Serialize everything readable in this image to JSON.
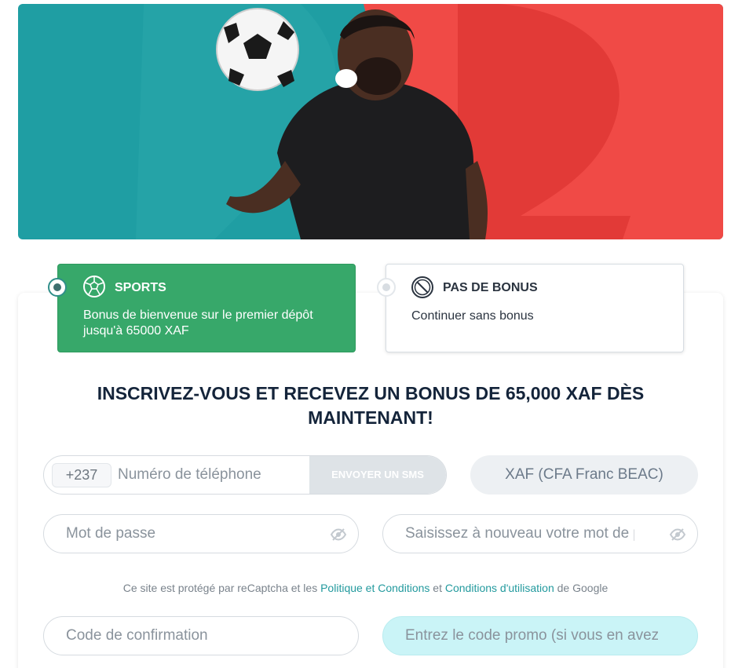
{
  "bonus_options": {
    "sports": {
      "title": "SPORTS",
      "description_line1": "Bonus de bienvenue sur le premier dépôt",
      "description_line2": "jusqu'à 65000 XAF",
      "icon": "soccer-ball-icon",
      "selected": true,
      "color": "#37a86a"
    },
    "no_bonus": {
      "title": "PAS DE BONUS",
      "description": "Continuer sans bonus",
      "icon": "prohibited-icon",
      "selected": false
    }
  },
  "heading": {
    "line1": "INSCRIVEZ-VOUS ET RECEVEZ UN BONUS DE 65,000 XAF DÈS",
    "line2": "MAINTENANT!"
  },
  "form": {
    "phone_prefix": "+237",
    "phone_placeholder": "Numéro de téléphone",
    "send_sms_label": "ENVOYER UN SMS",
    "currency": "XAF (CFA Franc BEAC)",
    "password_placeholder": "Mot de passe",
    "password_repeat_placeholder": "Saisissez à nouveau votre mot de passe",
    "confirmation_code_placeholder": "Code de confirmation",
    "promo_code_placeholder": "Entrez le code promo (si vous en avez)"
  },
  "recaptcha": {
    "prefix": "Ce site est protégé par reCaptcha et les",
    "policy_link": "Politique et Conditions",
    "middle": "et",
    "terms_link": "Conditions d'utilisation",
    "suffix": "de Google"
  },
  "colors": {
    "banner_teal": "#1f9ea3",
    "banner_red": "#f04a46",
    "accent_link": "#239a9e",
    "promo_field": "#caf4f7"
  }
}
